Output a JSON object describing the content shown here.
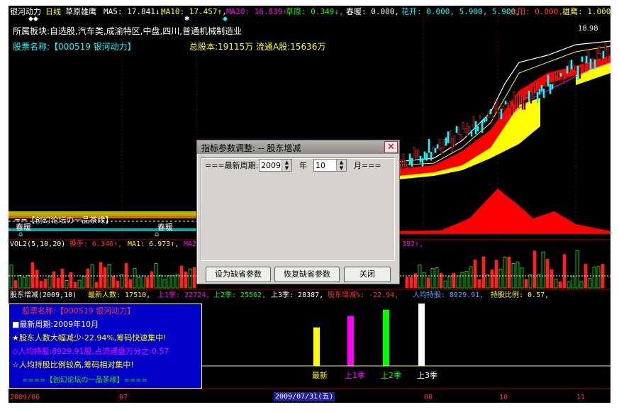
{
  "header": {
    "stock_name": "银河动力",
    "period": "日线",
    "indicator": "草原雄鹰",
    "ma5": "MA5: 17.841↓,",
    "ma10": "MA10: 17.457↑,",
    "ma20": "MA20: 16.839↑,",
    "caoyuan": "草原: 0.349↓,",
    "chunnuan": "春暖: 0.000,",
    "huakai": "花开: 0.000, 5.900, 5.900,",
    "taiyang": "太阳: 0.000,",
    "xiongying": "雄鹰: 1.000"
  },
  "info_lines": {
    "sector": "所属板块:自选股,汽车类,成渝特区,中盘,四川,普通机械制造业",
    "stock": "股票名称:【000519 银河动力】",
    "total_shares": "总股本:19115万",
    "float_shares": "流通A股:15636万",
    "price_label": "18.98"
  },
  "upper_chart_labels": {
    "left_overlay": "==【创幻论坛の一品茶缘】",
    "chunnuan_label": "春暖",
    "chunnuan_label2": "春暖"
  },
  "vol_header": {
    "vol": "VOL2(5,10,20)",
    "huanshou": "换手: 6.346↑,",
    "ma1": "MA1: 6.973↑,",
    "ma2": "MA2",
    "tail": "392↑,"
  },
  "gdzj_header": {
    "name": "股东增减(2009,10)",
    "latest": "最新人数: 17510,",
    "q1": "上1季: 22724,",
    "q2": "上2季: 25562,",
    "q3": "上3季: 28387,",
    "change": "股东增减%: -22.94,",
    "avg": "人均持股: 8929.91,",
    "ratio": "持股比例: 0.57,"
  },
  "info_box": {
    "stock": "股票名称:【000519 银河动力】",
    "period": "■最新周期:2009年10月",
    "line1": "★股东人数大幅减少-22.94%,筹码快速集中!",
    "line2": "◇人均持股:8929.91股,占流通盘万分之:0.57",
    "line3": "☆人均持股比例较高,筹码相对集中!",
    "footer": "====【创幻论坛の一品茶缘】===="
  },
  "bar_labels": [
    "最新",
    "上1季",
    "上2季",
    "上3季"
  ],
  "chart_data": {
    "type": "bar",
    "title": "股东增减(2009,10)",
    "categories": [
      "最新",
      "上1季",
      "上2季",
      "上3季"
    ],
    "values": [
      17510,
      22724,
      25562,
      28387
    ],
    "colors": [
      "#ffff00",
      "#ff00ff",
      "#00ff00",
      "#ffffff"
    ],
    "ylim": [
      0,
      30000
    ]
  },
  "dates": {
    "d1": "2009/06",
    "d2": "07",
    "cursor": "2009/07/31(五)",
    "d3": "08",
    "d4": "10",
    "d5": "11"
  },
  "dialog": {
    "title": "指标参数调整: -- 股东增减",
    "period_label": "===最新周期:",
    "year_value": "2009",
    "year_label": "年",
    "month_value": "10",
    "month_label": "月===",
    "btn_set_default": "设为缺省参数",
    "btn_restore": "恢复缺省参数",
    "btn_close": "关闭"
  },
  "colors": {
    "background": "#000000",
    "header_red": "#ff5050",
    "cyan": "#00ffff",
    "yellow": "#ffff00",
    "info_blue": "#0000c8"
  }
}
